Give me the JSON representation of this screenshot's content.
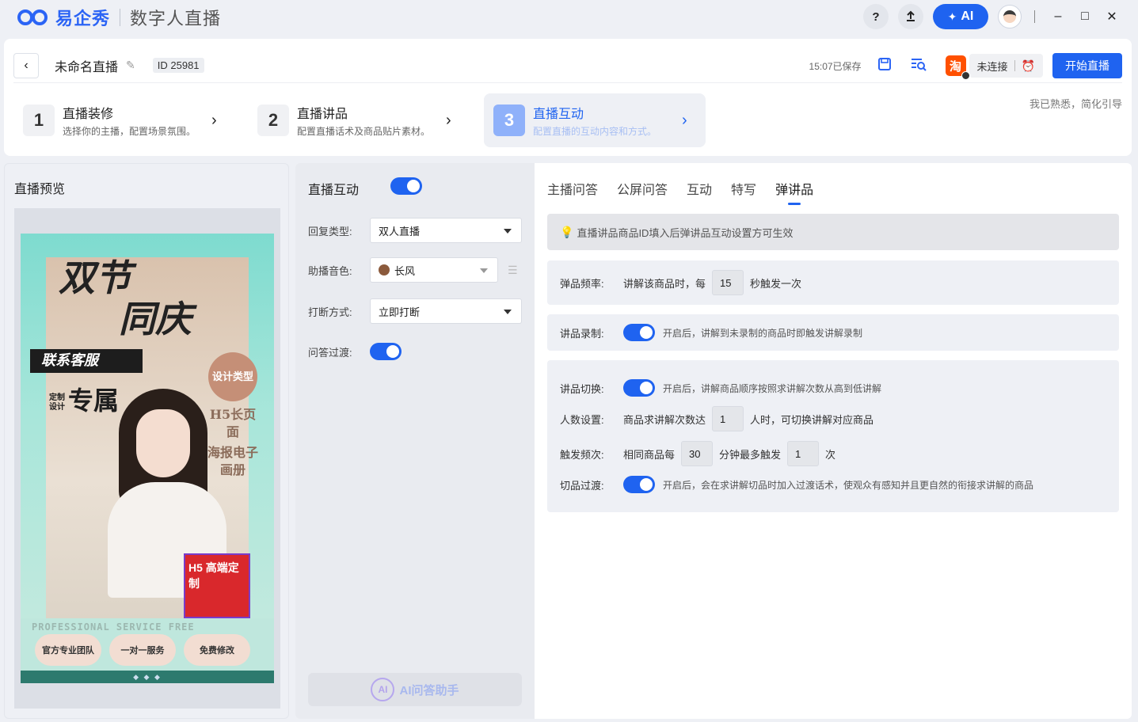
{
  "titlebar": {
    "brand": "易企秀",
    "app_title": "数字人直播",
    "help": "?",
    "upload_icon": "upload-icon",
    "ai_label": "AI",
    "minimize": "–",
    "maximize": "□",
    "close": "✕"
  },
  "header": {
    "live_name": "未命名直播",
    "id_label": "ID",
    "id_value": "25981",
    "saved_text": "15:07已保存",
    "platform_label": "淘",
    "connection": "未连接",
    "start_button": "开始直播",
    "guide_link": "我已熟悉，简化引导"
  },
  "steps": [
    {
      "num": "1",
      "title": "直播装修",
      "desc": "选择你的主播，配置场景氛围。"
    },
    {
      "num": "2",
      "title": "直播讲品",
      "desc": "配置直播话术及商品贴片素材。"
    },
    {
      "num": "3",
      "title": "直播互动",
      "desc": "配置直播的互动内容和方式。"
    }
  ],
  "preview": {
    "title": "直播预览",
    "poster": {
      "line1": "双节",
      "line2": "同庆",
      "contact": "联系客服",
      "exclusive": "专属",
      "custom_design": "定制设计",
      "side_circle": "设计类型",
      "side_items": [
        "H5长页面",
        "海报电子画册"
      ],
      "h5_badge": "H5 高端定制",
      "bottom_labels": "PROFESSIONAL   SERVICE   FREE",
      "pills": [
        "官方专业团队",
        "一对一服务",
        "免费修改"
      ]
    }
  },
  "interaction": {
    "title": "直播互动",
    "enabled": true,
    "reply_type_label": "回复类型:",
    "reply_type_value": "双人直播",
    "voice_label": "助播音色:",
    "voice_value": "长风",
    "interrupt_label": "打断方式:",
    "interrupt_value": "立即打断",
    "qa_transition_label": "问答过渡:",
    "qa_transition_enabled": true,
    "ai_assistant": "AI问答助手"
  },
  "tabs": [
    {
      "label": "主播问答",
      "active": false
    },
    {
      "label": "公屏问答",
      "active": false
    },
    {
      "label": "互动",
      "active": false
    },
    {
      "label": "特写",
      "active": false
    },
    {
      "label": "弹讲品",
      "active": true
    }
  ],
  "pop_product": {
    "notice": "直播讲品商品ID填入后弹讲品互动设置方可生效",
    "frequency_label": "弹品频率:",
    "frequency_prefix": "讲解该商品时，每",
    "frequency_value": "15",
    "frequency_suffix": "秒触发一次",
    "record_label": "讲品录制:",
    "record_hint": "开启后，讲解到未录制的商品时即触发讲解录制",
    "switch_label": "讲品切换:",
    "switch_hint": "开启后，讲解商品顺序按照求讲解次数从高到低讲解",
    "people_label": "人数设置:",
    "people_prefix": "商品求讲解次数达",
    "people_value": "1",
    "people_suffix": "人时，可切换讲解对应商品",
    "trigger_label": "触发频次:",
    "trigger_prefix": "相同商品每",
    "trigger_minutes": "30",
    "trigger_middle": "分钟最多触发",
    "trigger_count": "1",
    "trigger_suffix": "次",
    "transition_label": "切品过渡:",
    "transition_hint": "开启后，会在求讲解切品时加入过渡话术，使观众有感知并且更自然的衔接求讲解的商品"
  }
}
